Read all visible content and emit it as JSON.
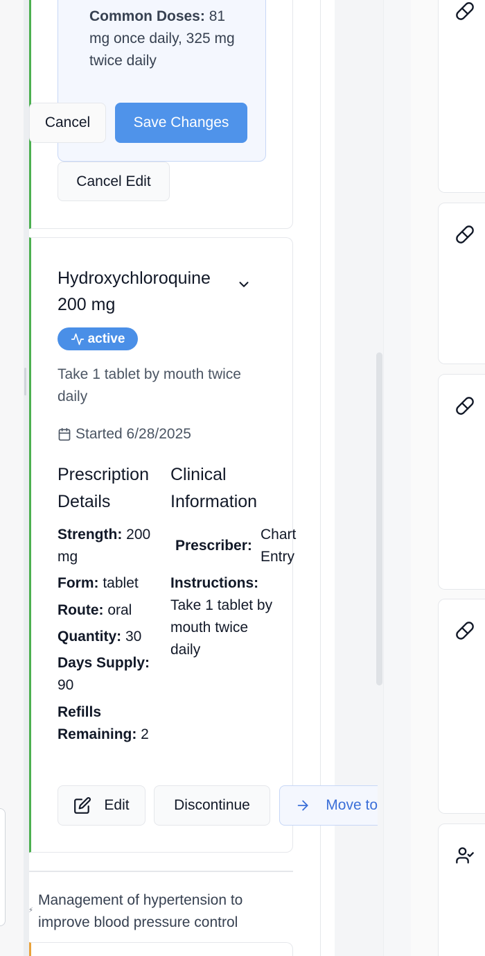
{
  "top_card": {
    "doses_label": "Common Doses:",
    "doses_value": " 81 mg once daily, 325 mg twice daily",
    "cancel_label": "Cancel",
    "save_label": "Save Changes",
    "cancel_edit_label": "Cancel Edit"
  },
  "medication": {
    "name": "Hydroxychloroquine 200 mg",
    "status": "active",
    "instructions": "Take 1 tablet by mouth twice daily",
    "started": "Started 6/28/2025",
    "prescription_heading": "Prescription Details",
    "clinical_heading": "Clinical Information",
    "strength_label": "Strength:",
    "strength_value": " 200 mg",
    "form_label": "Form:",
    "form_value": " tablet",
    "route_label": "Route:",
    "route_value": " oral",
    "quantity_label": "Quantity:",
    "quantity_value": " 30",
    "days_label": "Days Supply:",
    "days_value": " 90",
    "refills_label": "Refills Remaining:",
    "refills_value": " 2",
    "prescriber_label": "Prescriber:",
    "prescriber_value": "Chart Entry",
    "instructions_label": "Instructions:",
    "instructions_value": " Take 1 tablet by mouth twice daily",
    "edit_label": "Edit",
    "discontinue_label": "Discontinue",
    "move_label": "Move to"
  },
  "goal": {
    "text": "Management of hypertension to improve blood pressure control"
  },
  "colors": {
    "accent": "#4f93ea",
    "active_border": "#4caf50",
    "warning_border": "#e9a23b"
  },
  "icons": {
    "right_column": [
      "pill-icon",
      "pill-icon",
      "pill-icon",
      "pill-icon",
      "user-check-icon"
    ]
  }
}
